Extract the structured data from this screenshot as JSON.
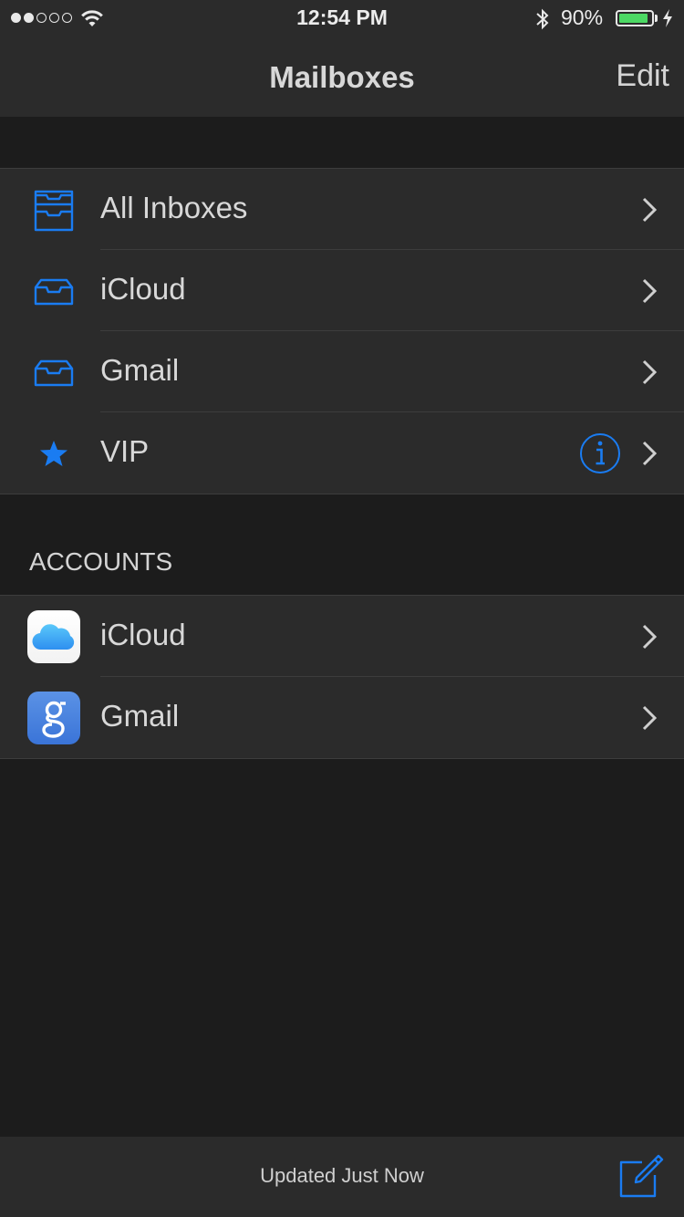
{
  "status_bar": {
    "time": "12:54 PM",
    "battery_percent": "90%",
    "battery_level": 0.9,
    "signal_bars_filled": 2,
    "signal_bars_total": 5
  },
  "nav": {
    "title": "Mailboxes",
    "edit_label": "Edit"
  },
  "mailboxes": [
    {
      "label": "All Inboxes",
      "icon": "all-inboxes-tray-icon"
    },
    {
      "label": "iCloud",
      "icon": "inbox-tray-icon"
    },
    {
      "label": "Gmail",
      "icon": "inbox-tray-icon"
    },
    {
      "label": "VIP",
      "icon": "star-icon"
    }
  ],
  "accounts": {
    "header": "ACCOUNTS",
    "items": [
      {
        "label": "iCloud",
        "icon": "icloud-app-icon"
      },
      {
        "label": "Gmail",
        "icon": "google-app-icon"
      }
    ]
  },
  "toolbar": {
    "status": "Updated Just Now"
  },
  "colors": {
    "accent_blue": "#1a7cf2",
    "background": "#1c1c1c",
    "bar_background": "#2b2b2b",
    "battery_green": "#4cd964"
  }
}
